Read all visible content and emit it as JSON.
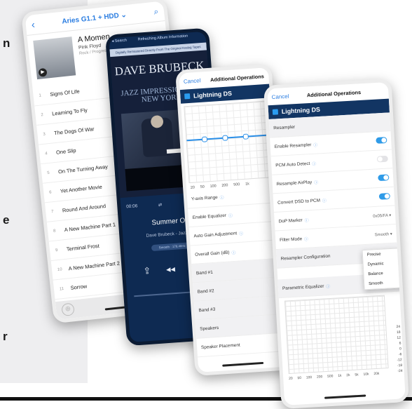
{
  "background": {
    "letters": [
      "n",
      "e",
      "r"
    ]
  },
  "phone1": {
    "nav": {
      "back": "‹",
      "title": "Aries G1.1 + HDD ⌄",
      "search": "⌕"
    },
    "album": {
      "name": "A Momen",
      "artist": "Pink Floyd",
      "genre": "Rock / Progress"
    },
    "tracks": [
      {
        "n": "1",
        "t": "Signs Of Life"
      },
      {
        "n": "2",
        "t": "Learning To Fly"
      },
      {
        "n": "3",
        "t": "The Dogs Of War"
      },
      {
        "n": "4",
        "t": "One Slip"
      },
      {
        "n": "5",
        "t": "On The Turning Away"
      },
      {
        "n": "6",
        "t": "Yet Another Movie"
      },
      {
        "n": "7",
        "t": "Round And Around"
      },
      {
        "n": "8",
        "t": "A New Machine Part 1"
      },
      {
        "n": "9",
        "t": "Terminal Frost"
      },
      {
        "n": "10",
        "t": "A New Machine Part 2"
      },
      {
        "n": "11",
        "t": "Sorrow"
      }
    ],
    "foot_icon": "⊕"
  },
  "phone2": {
    "status_left": "◂ Search",
    "status_center": "Refreshing Album Information",
    "strip": "Digitally Remastered Directly From The Original Analog Tapes",
    "cover_title": "DAVE BRUBECK",
    "cover_sub": "JAZZ IMPRESSIONS OF NEW YORK",
    "time_elapsed": "00:06",
    "song": "Summer On",
    "artist": "Dave Brubeck - Jazz Imp",
    "badge": "Smooth · 176.4kHz",
    "ctrl_share": "⇪",
    "ctrl_prev": "◂◂",
    "ctrl_pause": "▍▍"
  },
  "phone3": {
    "cancel": "Cancel",
    "title": "Additional Operations",
    "ds": "Lightning DS",
    "freqs": [
      "20",
      "50",
      "100",
      "200",
      "500",
      "1k"
    ],
    "rows": [
      {
        "label": "Y-axis Range",
        "info": true
      },
      {
        "label": "Enable Equalizer",
        "info": true
      },
      {
        "label": "Auto Gain Adjustment",
        "info": true
      },
      {
        "label": "Overall Gain (dB)",
        "info": true
      },
      {
        "label": "Band #1",
        "info": false
      },
      {
        "label": "Band #2",
        "info": false
      },
      {
        "label": "Band #3",
        "info": false
      }
    ],
    "speakers": "Speakers",
    "placement": "Speaker Placement"
  },
  "phone4": {
    "cancel": "Cancel",
    "title": "Additional Operations",
    "ds": "Lightning DS",
    "section": "Resampler",
    "rows": [
      {
        "label": "Enable Resampler",
        "toggle": "on"
      },
      {
        "label": "PCM Auto Detect",
        "toggle": "off"
      },
      {
        "label": "Resample AirPlay",
        "toggle": "on"
      },
      {
        "label": "Convert DSD to PCM",
        "toggle": "on"
      }
    ],
    "dop_label": "DoP Marker",
    "dop_value": "0x05/FA ▾",
    "filter_label": "Filter Mode",
    "filter_value": "Smooth ▾",
    "config": "Resampler Configuration",
    "popup": [
      "Precise",
      "Dynamic",
      "Balance",
      "Smooth"
    ],
    "peq": "Parametric Equalizer",
    "freqs": [
      "20",
      "50",
      "100",
      "200",
      "500",
      "1k",
      "2k",
      "5k",
      "10k",
      "20k"
    ],
    "ylabels": [
      "24",
      "18",
      "12",
      "6",
      "0",
      "-6",
      "-12",
      "-18",
      "-24"
    ]
  }
}
